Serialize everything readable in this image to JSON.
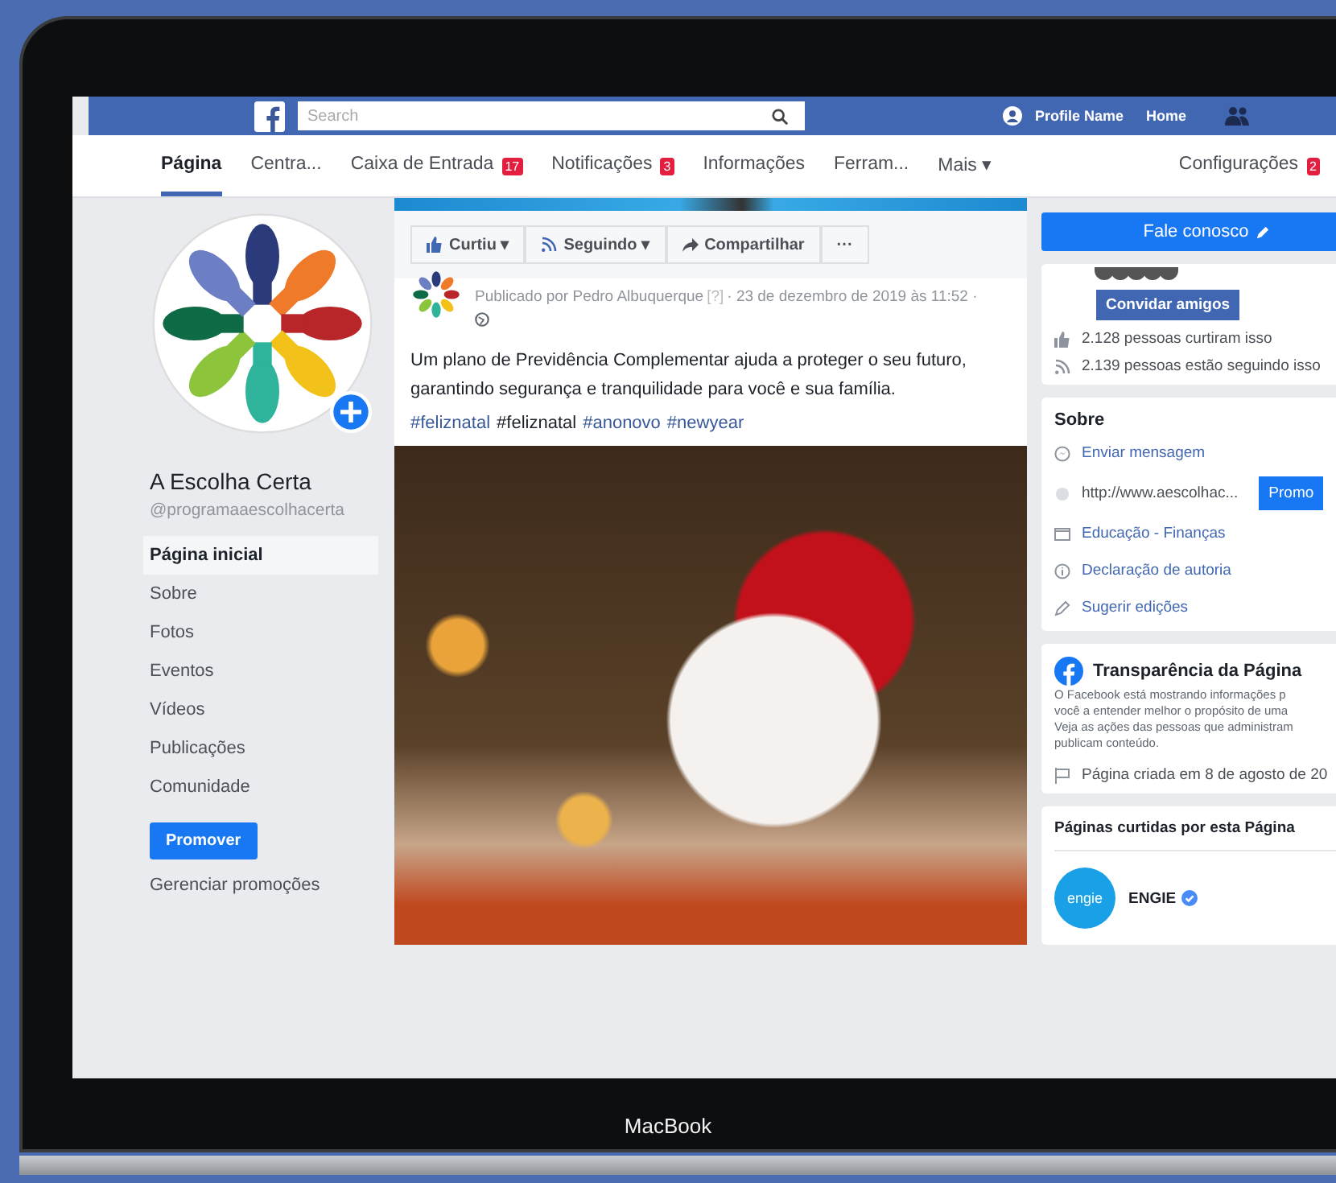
{
  "topbar": {
    "search": {
      "placeholder": "Search"
    },
    "profile_name": "Profile Name",
    "home": "Home"
  },
  "tabs": [
    {
      "label": "Página",
      "selected": true
    },
    {
      "label": "Centra...",
      "selected": false
    },
    {
      "label": "Caixa de Entrada",
      "badge": "17",
      "selected": false
    },
    {
      "label": "Notificações",
      "badge": "3",
      "selected": false
    },
    {
      "label": "Informações",
      "selected": false
    },
    {
      "label": "Ferram...",
      "selected": false
    },
    {
      "label": "Mais ▾",
      "selected": false
    }
  ],
  "settings_tab": {
    "label": "Configurações",
    "badge": "2"
  },
  "sidebar": {
    "page_name": "A Escolha Certa",
    "handle": "@programaaescolhacerta",
    "items": [
      {
        "label": "Página inicial",
        "selected": true
      },
      {
        "label": "Sobre",
        "selected": false
      },
      {
        "label": "Fotos",
        "selected": false
      },
      {
        "label": "Eventos",
        "selected": false
      },
      {
        "label": "Vídeos",
        "selected": false
      },
      {
        "label": "Publicações",
        "selected": false
      },
      {
        "label": "Comunidade",
        "selected": false
      }
    ],
    "promote_button": "Promover",
    "manage_link": "Gerenciar promoções"
  },
  "action_bar": [
    {
      "kind": "like",
      "label": "Curtiu ▾"
    },
    {
      "kind": "follow",
      "label": "Seguindo ▾"
    },
    {
      "kind": "share",
      "label": "Compartilhar"
    },
    {
      "kind": "more",
      "label": "···"
    }
  ],
  "post": {
    "byline": "Publicado por Pedro Albuquerque",
    "help": "[?]",
    "date": "· 23 de dezembro de 2019 às 11:52 ·",
    "text": "Um plano de Previdência Complementar ajuda a proteger o seu futuro, garantindo segurança e tranquilidade para você e sua família.",
    "hashtags": [
      {
        "kind": "link",
        "text": "#feliznatal"
      },
      {
        "kind": "plain",
        "text": "#feliznatal"
      },
      {
        "kind": "link",
        "text": "#anonovo"
      },
      {
        "kind": "link",
        "text": "#newyear"
      }
    ]
  },
  "right": {
    "contact_button": "Fale conosco",
    "invite_button": "Convidar amigos",
    "stats": [
      {
        "kind": "like",
        "text": "2.128 pessoas curtiram isso"
      },
      {
        "kind": "follow",
        "text": "2.139 pessoas estão seguindo isso"
      }
    ],
    "about": {
      "title": "Sobre",
      "items": [
        {
          "kind": "message",
          "text": "Enviar mensagem"
        },
        {
          "kind": "web",
          "text": "http://www.aescolhac...",
          "button": "Promo"
        },
        {
          "kind": "category",
          "text": "Educação - Finanças"
        },
        {
          "kind": "info",
          "text": "Declaração de autoria"
        },
        {
          "kind": "edit",
          "text": "Sugerir edições"
        }
      ]
    },
    "transparency": {
      "title": "Transparência da Página",
      "lines": [
        "O Facebook está mostrando informações p",
        "você a entender melhor o propósito de uma",
        "Veja as ações das pessoas que administram",
        "publicam conteúdo."
      ],
      "created": "Página criada em 8 de agosto de 20"
    },
    "liked_pages": {
      "title": "Páginas curtidas por esta Página",
      "pages": [
        {
          "logo_text": "engie",
          "name": "ENGIE",
          "verified": true
        }
      ]
    }
  },
  "laptop_label": "MacBook"
}
